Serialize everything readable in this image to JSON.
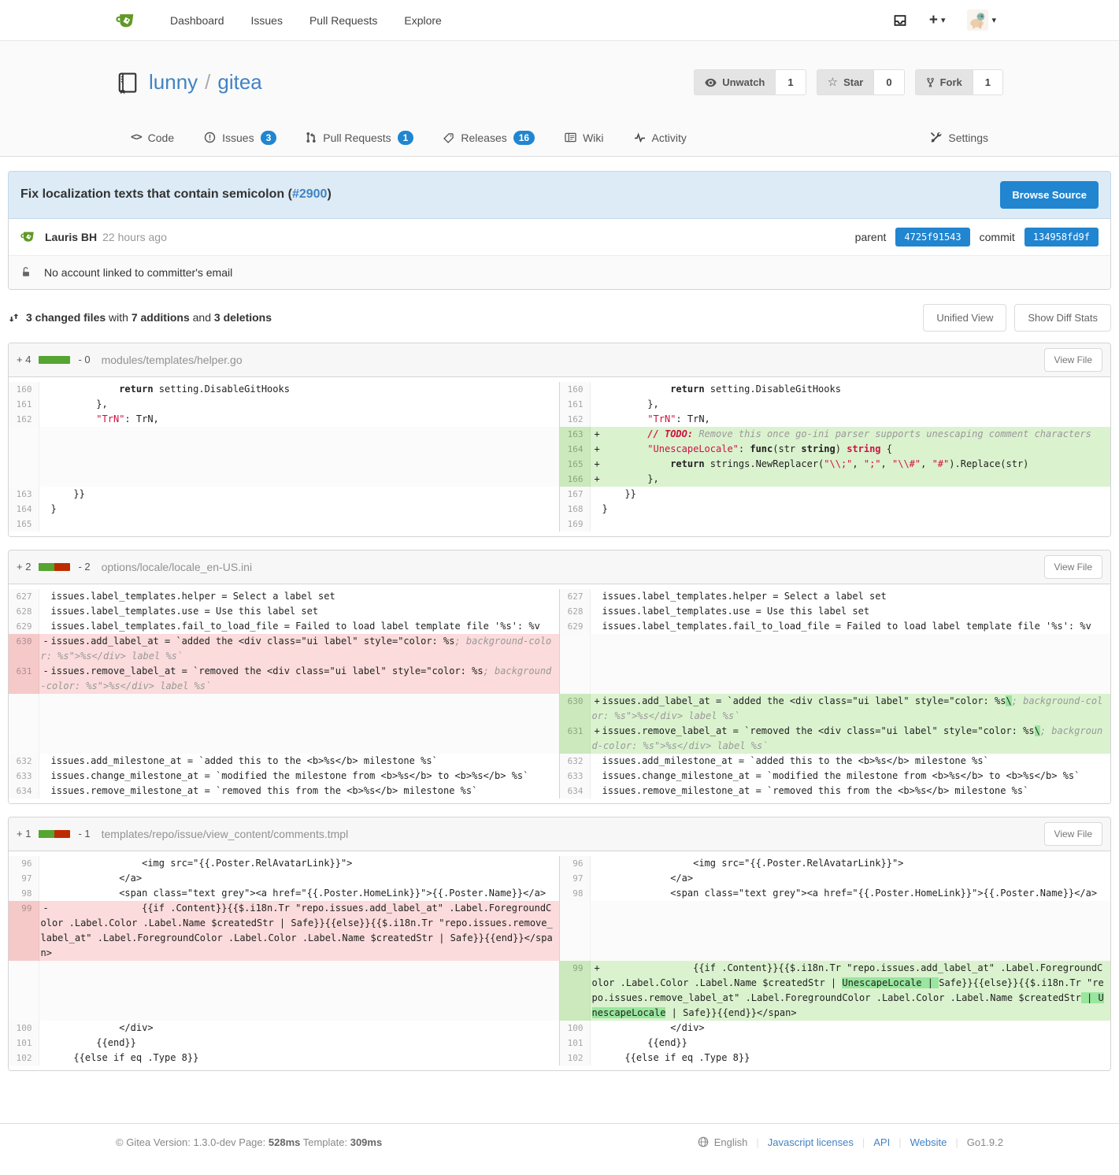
{
  "colors": {
    "accent_blue": "#2185d0",
    "link_blue": "#4183c4",
    "brand_green": "#609926",
    "bar_green": "#55a532",
    "bar_red": "#bd2c00",
    "add_bg": "#dbf2cf",
    "del_bg": "#fbdbdb",
    "inline_add_highlight": "#99e69e",
    "info_box_bg": "#dcebf5"
  },
  "icons": [
    "gitea-logo",
    "inbox-icon",
    "plus-icon",
    "caret-down-icon",
    "avatar",
    "book-icon",
    "eye-icon",
    "star-icon",
    "fork-icon",
    "code-icon",
    "issue-icon",
    "pull-request-icon",
    "tag-icon",
    "wiki-icon",
    "activity-icon",
    "settings-icon",
    "unlock-icon",
    "diff-icon",
    "globe-icon"
  ],
  "navbar": {
    "menu": [
      {
        "label": "Dashboard"
      },
      {
        "label": "Issues"
      },
      {
        "label": "Pull Requests"
      },
      {
        "label": "Explore"
      }
    ]
  },
  "header": {
    "owner": "lunny",
    "slash": "/",
    "name": "gitea",
    "actions": [
      {
        "label": "Unwatch",
        "count": "1"
      },
      {
        "label": "Star",
        "count": "0"
      },
      {
        "label": "Fork",
        "count": "1"
      }
    ]
  },
  "tabs": {
    "items": [
      {
        "label": "Code"
      },
      {
        "label": "Issues",
        "badge": "3"
      },
      {
        "label": "Pull Requests",
        "badge": "1"
      },
      {
        "label": "Releases",
        "badge": "16"
      },
      {
        "label": "Wiki"
      },
      {
        "label": "Activity"
      }
    ],
    "settings": "Settings"
  },
  "commit": {
    "title_pre": "Fix localization texts that contain semicolon (",
    "issue": "#2900",
    "title_post": ")",
    "browse": "Browse Source",
    "author": "Lauris BH",
    "time": "22 hours ago",
    "parent_label": "parent",
    "parent_sha": "4725f91543",
    "commit_label": "commit",
    "commit_sha": "134958fd9f",
    "warning": "No account linked to committer's email"
  },
  "stats": {
    "changed": "3 changed files",
    "with": " with ",
    "adds": "7 additions",
    "and": " and ",
    "dels": "3 deletions",
    "unified": "Unified View",
    "show": "Show Diff Stats"
  },
  "diffs": [
    {
      "adds": "+ 4",
      "dels": "- 0",
      "green": 100,
      "filename": "modules/templates/helper.go",
      "view_file": "View File",
      "rows": [
        {
          "l": {
            "n": "160",
            "t": "ctx",
            "seg": [
              [
                "            ",
                ""
              ],
              [
                "return",
                "k"
              ],
              [
                " setting.DisableGitHooks",
                ""
              ]
            ]
          },
          "r": {
            "n": "160",
            "t": "ctx",
            "seg": [
              [
                "            ",
                ""
              ],
              [
                "return",
                "k"
              ],
              [
                " setting.DisableGitHooks",
                ""
              ]
            ]
          }
        },
        {
          "l": {
            "n": "161",
            "t": "ctx",
            "seg": [
              [
                "        },",
                ""
              ]
            ]
          },
          "r": {
            "n": "161",
            "t": "ctx",
            "seg": [
              [
                "        },",
                ""
              ]
            ]
          }
        },
        {
          "l": {
            "n": "162",
            "t": "ctx",
            "seg": [
              [
                "        ",
                ""
              ],
              [
                "\"TrN\"",
                "s"
              ],
              [
                ": TrN,",
                ""
              ]
            ]
          },
          "r": {
            "n": "162",
            "t": "ctx",
            "seg": [
              [
                "        ",
                ""
              ],
              [
                "\"TrN\"",
                "s"
              ],
              [
                ": TrN,",
                ""
              ]
            ]
          }
        },
        {
          "l": null,
          "r": {
            "n": "163",
            "t": "add",
            "seg": [
              [
                "        ",
                ""
              ],
              [
                "// TODO:",
                "ct"
              ],
              [
                " Remove this once go-ini parser supports unescaping comment characters",
                "c"
              ]
            ]
          }
        },
        {
          "l": null,
          "r": {
            "n": "164",
            "t": "add",
            "seg": [
              [
                "        ",
                ""
              ],
              [
                "\"UnescapeLocale\"",
                "s"
              ],
              [
                ": ",
                ""
              ],
              [
                "func",
                "k"
              ],
              [
                "(str ",
                ""
              ],
              [
                "string",
                "k"
              ],
              [
                ") ",
                ""
              ],
              [
                "string",
                "ks"
              ],
              [
                " {",
                ""
              ]
            ]
          }
        },
        {
          "l": null,
          "r": {
            "n": "165",
            "t": "add",
            "seg": [
              [
                "            ",
                ""
              ],
              [
                "return",
                "k"
              ],
              [
                " strings.NewReplacer(",
                ""
              ],
              [
                "\"\\\\;\"",
                "s"
              ],
              [
                ", ",
                ""
              ],
              [
                "\";\"",
                "s"
              ],
              [
                ", ",
                ""
              ],
              [
                "\"\\\\#\"",
                "s"
              ],
              [
                ", ",
                ""
              ],
              [
                "\"#\"",
                "s"
              ],
              [
                ").Replace(str)",
                ""
              ]
            ]
          }
        },
        {
          "l": null,
          "r": {
            "n": "166",
            "t": "add",
            "seg": [
              [
                "        },",
                ""
              ]
            ]
          }
        },
        {
          "l": {
            "n": "163",
            "t": "ctx",
            "seg": [
              [
                "    }}",
                ""
              ]
            ]
          },
          "r": {
            "n": "167",
            "t": "ctx",
            "seg": [
              [
                "    }}",
                ""
              ]
            ]
          }
        },
        {
          "l": {
            "n": "164",
            "t": "ctx",
            "seg": [
              [
                "}",
                ""
              ]
            ]
          },
          "r": {
            "n": "168",
            "t": "ctx",
            "seg": [
              [
                "}",
                ""
              ]
            ]
          }
        },
        {
          "l": {
            "n": "165",
            "t": "ctx",
            "seg": []
          },
          "r": {
            "n": "169",
            "t": "ctx",
            "seg": []
          }
        }
      ]
    },
    {
      "adds": "+ 2",
      "dels": "- 2",
      "green": 50,
      "filename": "options/locale/locale_en-US.ini",
      "view_file": "View File",
      "rows": [
        {
          "l": {
            "n": "627",
            "t": "ctx",
            "seg": [
              [
                "issues.label_templates.helper = Select a label set",
                ""
              ]
            ]
          },
          "r": {
            "n": "627",
            "t": "ctx",
            "seg": [
              [
                "issues.label_templates.helper = Select a label set",
                ""
              ]
            ]
          }
        },
        {
          "l": {
            "n": "628",
            "t": "ctx",
            "seg": [
              [
                "issues.label_templates.use = Use this label set",
                ""
              ]
            ]
          },
          "r": {
            "n": "628",
            "t": "ctx",
            "seg": [
              [
                "issues.label_templates.use = Use this label set",
                ""
              ]
            ]
          }
        },
        {
          "l": {
            "n": "629",
            "t": "ctx",
            "seg": [
              [
                "issues.label_templates.fail_to_load_file = Failed to load label template file '%s': %v",
                ""
              ]
            ]
          },
          "r": {
            "n": "629",
            "t": "ctx",
            "seg": [
              [
                "issues.label_templates.fail_to_load_file = Failed to load label template file '%s': %v",
                ""
              ]
            ]
          }
        },
        {
          "l": {
            "n": "630",
            "t": "del",
            "seg": [
              [
                "issues.add_label_at = `added the <div class=\"ui label\" style=\"color: %s",
                ""
              ],
              [
                "; background-color: %s\">%s</div> label %s`",
                "c"
              ]
            ]
          },
          "r": null
        },
        {
          "l": {
            "n": "631",
            "t": "del",
            "seg": [
              [
                "issues.remove_label_at = `removed the <div class=\"ui label\" style=\"color: %s",
                ""
              ],
              [
                "; background-color: %s\">%s</div> label %s`",
                "c"
              ]
            ]
          },
          "r": null
        },
        {
          "l": null,
          "r": {
            "n": "630",
            "t": "add",
            "seg": [
              [
                "issues.add_label_at = `added the <div class=\"ui label\" style=\"color: %s",
                ""
              ],
              [
                "\\",
                "hl"
              ],
              [
                "; background-color: %s\">%s</div> label %s`",
                "c"
              ]
            ]
          }
        },
        {
          "l": null,
          "r": {
            "n": "631",
            "t": "add",
            "seg": [
              [
                "issues.remove_label_at = `removed the <div class=\"ui label\" style=\"color: %s",
                ""
              ],
              [
                "\\",
                "hl"
              ],
              [
                "; background-color: %s\">%s</div> label %s`",
                "c"
              ]
            ]
          }
        },
        {
          "l": {
            "n": "632",
            "t": "ctx",
            "seg": [
              [
                "issues.add_milestone_at = `added this to the <b>%s</b> milestone %s`",
                ""
              ]
            ]
          },
          "r": {
            "n": "632",
            "t": "ctx",
            "seg": [
              [
                "issues.add_milestone_at = `added this to the <b>%s</b> milestone %s`",
                ""
              ]
            ]
          }
        },
        {
          "l": {
            "n": "633",
            "t": "ctx",
            "seg": [
              [
                "issues.change_milestone_at = `modified the milestone from <b>%s</b> to <b>%s</b> %s`",
                ""
              ]
            ]
          },
          "r": {
            "n": "633",
            "t": "ctx",
            "seg": [
              [
                "issues.change_milestone_at = `modified the milestone from <b>%s</b> to <b>%s</b> %s`",
                ""
              ]
            ]
          }
        },
        {
          "l": {
            "n": "634",
            "t": "ctx",
            "seg": [
              [
                "issues.remove_milestone_at = `removed this from the <b>%s</b> milestone %s`",
                ""
              ]
            ]
          },
          "r": {
            "n": "634",
            "t": "ctx",
            "seg": [
              [
                "issues.remove_milestone_at = `removed this from the <b>%s</b> milestone %s`",
                ""
              ]
            ]
          }
        }
      ]
    },
    {
      "adds": "+ 1",
      "dels": "- 1",
      "green": 50,
      "filename": "templates/repo/issue/view_content/comments.tmpl",
      "view_file": "View File",
      "rows": [
        {
          "l": {
            "n": "96",
            "t": "ctx",
            "seg": [
              [
                "                <img src=\"{{.Poster.RelAvatarLink}}\">",
                ""
              ]
            ]
          },
          "r": {
            "n": "96",
            "t": "ctx",
            "seg": [
              [
                "                <img src=\"{{.Poster.RelAvatarLink}}\">",
                ""
              ]
            ]
          }
        },
        {
          "l": {
            "n": "97",
            "t": "ctx",
            "seg": [
              [
                "            </a>",
                ""
              ]
            ]
          },
          "r": {
            "n": "97",
            "t": "ctx",
            "seg": [
              [
                "            </a>",
                ""
              ]
            ]
          }
        },
        {
          "l": {
            "n": "98",
            "t": "ctx",
            "seg": [
              [
                "            <span class=\"text grey\"><a href=\"{{.Poster.HomeLink}}\">{{.Poster.Name}}</a>",
                ""
              ]
            ]
          },
          "r": {
            "n": "98",
            "t": "ctx",
            "seg": [
              [
                "            <span class=\"text grey\"><a href=\"{{.Poster.HomeLink}}\">{{.Poster.Name}}</a>",
                ""
              ]
            ]
          }
        },
        {
          "l": {
            "n": "99",
            "t": "del",
            "seg": [
              [
                "                {{if .Content}}{{$.i18n.Tr \"repo.issues.add_label_at\" .Label.ForegroundColor .Label.Color .Label.Name $createdStr | Safe}}{{else}}{{$.i18n.Tr \"repo.issues.remove_label_at\" .Label.ForegroundColor .Label.Color .Label.Name $createdStr | Safe}}{{end}}</span>",
                ""
              ]
            ]
          },
          "r": null
        },
        {
          "l": null,
          "r": {
            "n": "99",
            "t": "add",
            "seg": [
              [
                "                {{if .Content}}{{$.i18n.Tr \"repo.issues.add_label_at\" .Label.ForegroundColor .Label.Color .Label.Name $createdStr | ",
                ""
              ],
              [
                "UnescapeLocale | ",
                "hl"
              ],
              [
                "Safe}}{{else}}{{$.i18n.Tr \"repo.issues.remove_label_at\" .Label.ForegroundColor .Label.Color .Label.Name $createdStr",
                ""
              ],
              [
                " | UnescapeLocale",
                "hl"
              ],
              [
                " | Safe}}{{end}}</span>",
                ""
              ]
            ]
          }
        },
        {
          "l": {
            "n": "100",
            "t": "ctx",
            "seg": [
              [
                "            </div>",
                ""
              ]
            ]
          },
          "r": {
            "n": "100",
            "t": "ctx",
            "seg": [
              [
                "            </div>",
                ""
              ]
            ]
          }
        },
        {
          "l": {
            "n": "101",
            "t": "ctx",
            "seg": [
              [
                "        {{end}}",
                ""
              ]
            ]
          },
          "r": {
            "n": "101",
            "t": "ctx",
            "seg": [
              [
                "        {{end}}",
                ""
              ]
            ]
          }
        },
        {
          "l": {
            "n": "102",
            "t": "ctx",
            "seg": [
              [
                "    {{else if eq .Type 8}}",
                ""
              ]
            ]
          },
          "r": {
            "n": "102",
            "t": "ctx",
            "seg": [
              [
                "    {{else if eq .Type 8}}",
                ""
              ]
            ]
          }
        }
      ]
    }
  ],
  "footer": {
    "copy": "© Gitea Version: ",
    "version": "1.3.0-dev",
    "page": " Page: ",
    "page_ms": "528ms",
    "template": " Template: ",
    "tpl_ms": "309ms",
    "lang": "English",
    "links": [
      "Javascript licenses",
      "API",
      "Website"
    ],
    "go": "Go1.9.2"
  }
}
